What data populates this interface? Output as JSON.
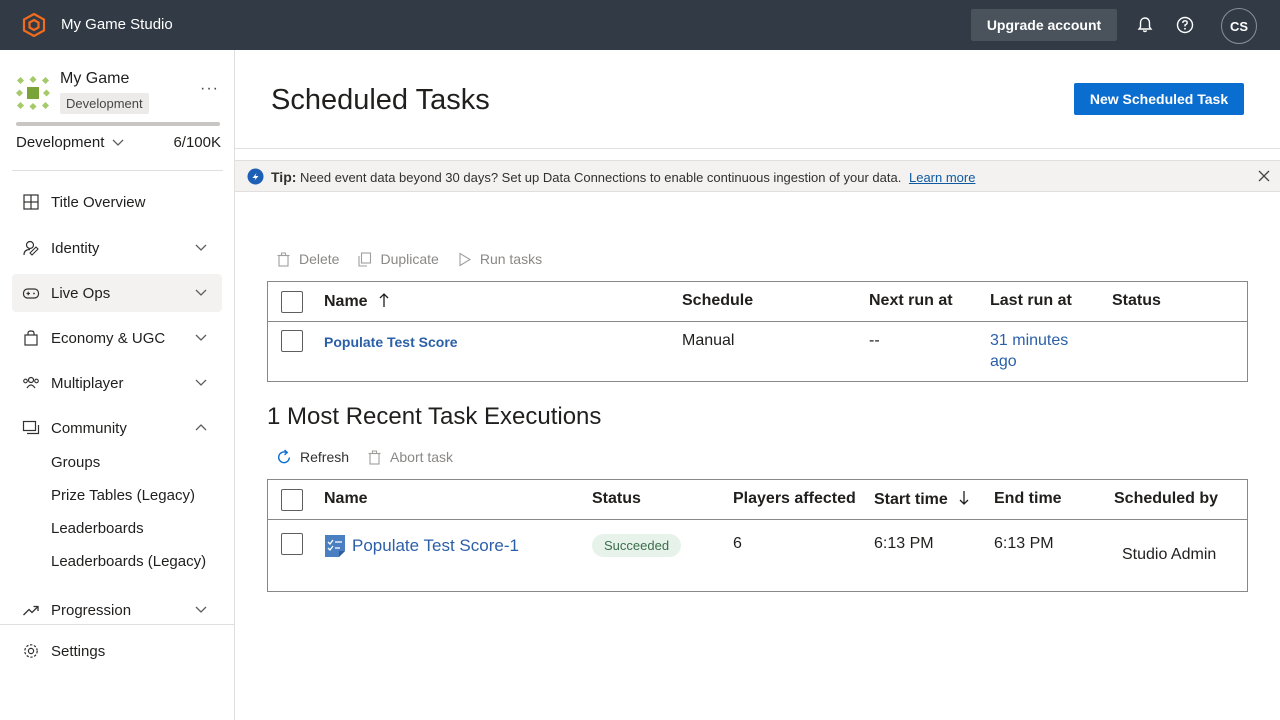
{
  "topbar": {
    "studio_name": "My Game Studio",
    "upgrade_label": "Upgrade account",
    "avatar_initials": "CS"
  },
  "sidebar": {
    "game_title": "My Game",
    "env_badge": "Development",
    "env_selected": "Development",
    "usage": "6/100K",
    "usage_fraction": 6e-05,
    "nav": [
      {
        "label": "Title Overview",
        "icon": "grid-icon"
      },
      {
        "label": "Identity",
        "icon": "identity-icon"
      },
      {
        "label": "Live Ops",
        "icon": "gamepad-icon"
      },
      {
        "label": "Economy & UGC",
        "icon": "bag-icon"
      },
      {
        "label": "Multiplayer",
        "icon": "people-icon"
      },
      {
        "label": "Community",
        "icon": "community-icon"
      },
      {
        "label": "Progression",
        "icon": "trend-icon"
      }
    ],
    "community_sub": [
      "Groups",
      "Prize Tables (Legacy)",
      "Leaderboards",
      "Leaderboards (Legacy)"
    ],
    "settings_label": "Settings"
  },
  "main": {
    "title": "Scheduled Tasks",
    "new_task_label": "New Scheduled Task",
    "tip": {
      "label": "Tip:",
      "text": "Need event data beyond 30 days? Set up Data Connections to enable continuous ingestion of your data.",
      "link": "Learn more"
    },
    "task_cmds": {
      "delete": "Delete",
      "duplicate": "Duplicate",
      "run": "Run tasks"
    },
    "tasks_table": {
      "headers": {
        "name": "Name",
        "schedule": "Schedule",
        "next_run": "Next run at",
        "last_run": "Last run at",
        "status": "Status"
      },
      "rows": [
        {
          "name": "Populate Test Score",
          "schedule": "Manual",
          "next_run": "--",
          "last_run_1": "31 minutes",
          "last_run_2": "ago",
          "status": ""
        }
      ]
    },
    "executions_title": "1 Most Recent Task Executions",
    "exec_cmds": {
      "refresh": "Refresh",
      "abort": "Abort task"
    },
    "exec_table": {
      "headers": {
        "name": "Name",
        "status": "Status",
        "players": "Players affected",
        "start": "Start time",
        "end": "End time",
        "by": "Scheduled by"
      },
      "rows": [
        {
          "name": "Populate Test Score-1",
          "status": "Succeeded",
          "players": "6",
          "start": "6:13 PM",
          "end": "6:13 PM",
          "by": "Studio Admin"
        }
      ]
    }
  },
  "colors": {
    "topbar": "#323a45",
    "primary_button": "#0a6ed1",
    "link": "#2b5fa8",
    "success_pill_bg": "#e6f2ea",
    "success_pill_text": "#3b6e4b"
  }
}
